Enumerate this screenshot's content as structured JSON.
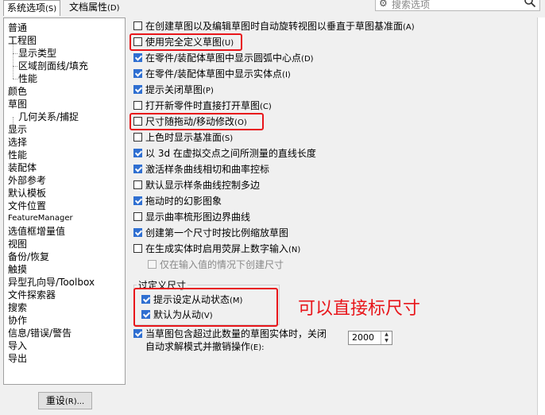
{
  "tabs": [
    {
      "label": "系统选项",
      "key": "(S)"
    },
    {
      "label": "文档属性",
      "key": "(D)"
    }
  ],
  "search": {
    "placeholder": "搜索选项"
  },
  "tree": [
    {
      "label": "普通",
      "level": 1
    },
    {
      "label": "工程图",
      "level": 1
    },
    {
      "label": "显示类型",
      "level": 2
    },
    {
      "label": "区域剖面线/填充",
      "level": 2
    },
    {
      "label": "性能",
      "level": 2
    },
    {
      "label": "颜色",
      "level": 1
    },
    {
      "label": "草图",
      "level": 1
    },
    {
      "label": "几何关系/捕捉",
      "level": 2
    },
    {
      "label": "显示",
      "level": 1
    },
    {
      "label": "选择",
      "level": 1
    },
    {
      "label": "性能",
      "level": 1
    },
    {
      "label": "装配体",
      "level": 1
    },
    {
      "label": "外部参考",
      "level": 1
    },
    {
      "label": "默认模板",
      "level": 1
    },
    {
      "label": "文件位置",
      "level": 1
    },
    {
      "label": "FeatureManager",
      "level": 1
    },
    {
      "label": "选值框增量值",
      "level": 1
    },
    {
      "label": "视图",
      "level": 1
    },
    {
      "label": "备份/恢复",
      "level": 1
    },
    {
      "label": "触摸",
      "level": 1
    },
    {
      "label": "异型孔向导/Toolbox",
      "level": 1
    },
    {
      "label": "文件探索器",
      "level": 1
    },
    {
      "label": "搜索",
      "level": 1
    },
    {
      "label": "协作",
      "level": 1
    },
    {
      "label": "信息/错误/警告",
      "level": 1
    },
    {
      "label": "导入",
      "level": 1
    },
    {
      "label": "导出",
      "level": 1
    }
  ],
  "reset": {
    "label": "重设",
    "key": "(R)..."
  },
  "options": [
    {
      "label": "在创建草图以及编辑草图时自动旋转视图以垂直于草图基准面",
      "key": "(A)",
      "checked": false
    },
    {
      "label": "使用完全定义草图",
      "key": "(U)",
      "checked": false
    },
    {
      "label": "在零件/装配体草图中显示圆弧中心点",
      "key": "(D)",
      "checked": true
    },
    {
      "label": "在零件/装配体草图中显示实体点",
      "key": "(I)",
      "checked": true
    },
    {
      "label": "提示关闭草图",
      "key": "(P)",
      "checked": true
    },
    {
      "label": "打开新零件时直接打开草图",
      "key": "(C)",
      "checked": false
    },
    {
      "label": "尺寸随拖动/移动修改",
      "key": "(O)",
      "checked": false
    },
    {
      "label": "上色时显示基准面",
      "key": "(S)",
      "checked": false
    },
    {
      "label": "以 3d 在虚拟交点之间所测量的直线长度",
      "key": "",
      "checked": true
    },
    {
      "label": "激活样条曲线相切和曲率控标",
      "key": "",
      "checked": true
    },
    {
      "label": "默认显示样条曲线控制多边",
      "key": "",
      "checked": false
    },
    {
      "label": "拖动时的幻影图象",
      "key": "",
      "checked": true
    },
    {
      "label": "显示曲率梳形图边界曲线",
      "key": "",
      "checked": false
    },
    {
      "label": "创建第一个尺寸时按比例缩放草图",
      "key": "",
      "checked": true
    },
    {
      "label": "在生成实体时启用荧屏上数字输入",
      "key": "(N)",
      "checked": false
    }
  ],
  "sub_option": {
    "label": "仅在输入值的情况下创建尺寸",
    "checked": false
  },
  "group": {
    "title": "过定义尺寸",
    "options": [
      {
        "label": "提示设定从动状态",
        "key": "(M)",
        "checked": true
      },
      {
        "label": "默认为从动",
        "key": "(V)",
        "checked": true
      }
    ]
  },
  "limit_option": {
    "line1": "当草图包含超过此数量的草图实体时，关闭",
    "line2": "自动求解模式并撤销操作",
    "key": "(E):",
    "checked": true,
    "value": "2000"
  },
  "annotation": "可以直接标尺寸",
  "colors": {
    "accent": "#2f6fd1",
    "highlight": "#e8161b"
  }
}
